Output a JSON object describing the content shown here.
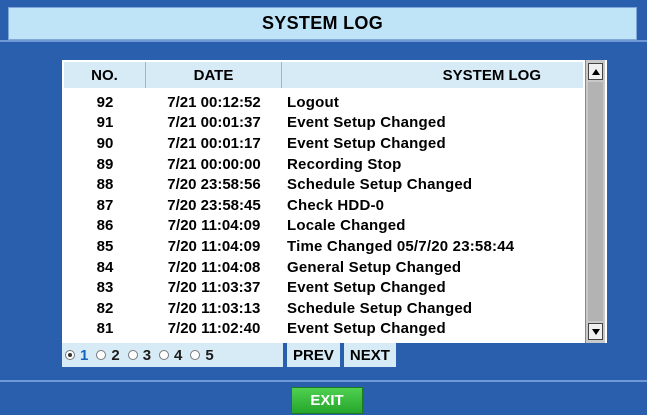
{
  "title": "SYSTEM LOG",
  "table": {
    "headers": {
      "no": "NO.",
      "date": "DATE",
      "log": "SYSTEM LOG"
    },
    "rows": [
      {
        "no": "92",
        "date": "7/21 00:12:52",
        "log": "Logout"
      },
      {
        "no": "91",
        "date": "7/21 00:01:37",
        "log": "Event Setup Changed"
      },
      {
        "no": "90",
        "date": "7/21 00:01:17",
        "log": "Event Setup Changed"
      },
      {
        "no": "89",
        "date": "7/21 00:00:00",
        "log": "Recording Stop"
      },
      {
        "no": "88",
        "date": "7/20 23:58:56",
        "log": "Schedule Setup Changed"
      },
      {
        "no": "87",
        "date": "7/20 23:58:45",
        "log": "Check HDD-0"
      },
      {
        "no": "86",
        "date": "7/20 11:04:09",
        "log": "Locale Changed"
      },
      {
        "no": "85",
        "date": "7/20 11:04:09",
        "log": "Time Changed 05/7/20 23:58:44"
      },
      {
        "no": "84",
        "date": "7/20 11:04:08",
        "log": "General Setup Changed"
      },
      {
        "no": "83",
        "date": "7/20 11:03:37",
        "log": "Event Setup Changed"
      },
      {
        "no": "82",
        "date": "7/20 11:03:13",
        "log": "Schedule Setup Changed"
      },
      {
        "no": "81",
        "date": "7/20 11:02:40",
        "log": "Event Setup Changed"
      }
    ]
  },
  "pager": {
    "pages": [
      "1",
      "2",
      "3",
      "4",
      "5"
    ],
    "selected": "1",
    "prev_label": "PREV",
    "next_label": "NEXT"
  },
  "exit_label": "EXIT",
  "colors": {
    "background": "#2a5fae",
    "title_bar": "#bfe4f8",
    "header_bg": "#d7ebf6",
    "selected_page": "#1565c0",
    "exit_button": "#26a62b"
  }
}
